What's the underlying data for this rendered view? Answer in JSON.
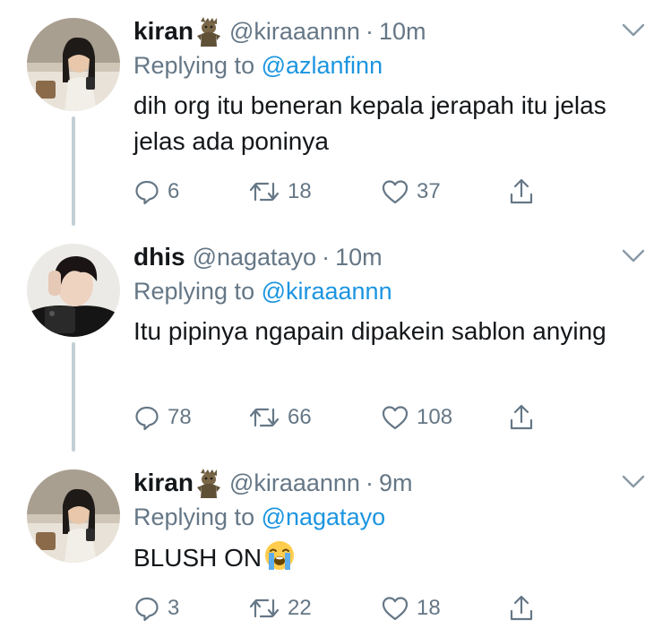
{
  "colors": {
    "text": "#14171a",
    "muted": "#657786",
    "link": "#1b95e0",
    "thread_line": "#c4cfd6"
  },
  "tweets": [
    {
      "name": "kiran",
      "badge_icon": "groot-emoji-icon",
      "handle": "@kiraaannn",
      "separator": "·",
      "time": "10m",
      "replying_prefix": "Replying to ",
      "replying_to": "@azlanfinn",
      "text": "dih org itu beneran kepala jerapah itu jelas jelas ada poninya",
      "replies": "6",
      "retweets": "18",
      "likes": "37"
    },
    {
      "name": "dhis",
      "handle": "@nagatayo",
      "separator": "·",
      "time": "10m",
      "replying_prefix": "Replying to ",
      "replying_to": "@kiraaannn",
      "text": "Itu pipinya ngapain dipakein sablon anying",
      "replies": "78",
      "retweets": "66",
      "likes": "108"
    },
    {
      "name": "kiran",
      "badge_icon": "groot-emoji-icon",
      "handle": "@kiraaannn",
      "separator": "·",
      "time": "9m",
      "replying_prefix": "Replying to ",
      "replying_to": "@nagatayo",
      "text": "BLUSH ON",
      "text_emoji": "loudly-crying-face-icon",
      "replies": "3",
      "retweets": "22",
      "likes": "18"
    }
  ]
}
